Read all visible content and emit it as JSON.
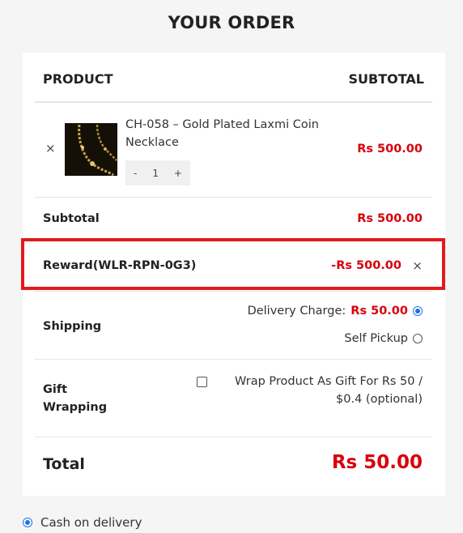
{
  "heading": "YOUR ORDER",
  "columns": {
    "product": "PRODUCT",
    "subtotal": "SUBTOTAL"
  },
  "item": {
    "remove": "×",
    "name": "CH-058 – Gold Plated Laxmi Coin Necklace",
    "qty_minus": "-",
    "qty": "1",
    "qty_plus": "+",
    "price": "Rs 500.00"
  },
  "subtotal": {
    "label": "Subtotal",
    "value": "Rs 500.00"
  },
  "reward": {
    "label": "Reward(WLR-RPN-0G3)",
    "value": "-Rs 500.00",
    "remove": "×"
  },
  "shipping": {
    "label": "Shipping",
    "delivery_label": "Delivery Charge:",
    "delivery_value": "Rs 50.00",
    "delivery_selected": true,
    "pickup_label": "Self Pickup",
    "pickup_selected": false
  },
  "gift": {
    "label": "Gift Wrapping",
    "option_text": "Wrap Product As Gift For Rs 50 / $0.4 (optional)",
    "checked": false
  },
  "total": {
    "label": "Total",
    "value": "Rs 50.00"
  },
  "payment": {
    "label": "Cash on delivery",
    "selected": true
  },
  "colors": {
    "accent_red": "#d8000c",
    "highlight_border": "#e21b1b",
    "radio_blue": "#1a73e8"
  }
}
